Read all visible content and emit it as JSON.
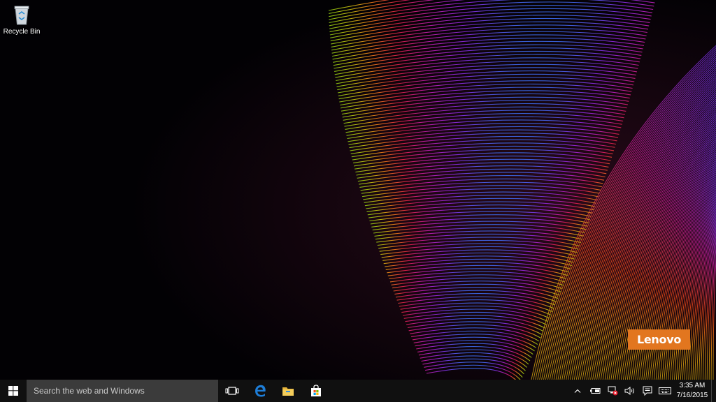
{
  "desktop": {
    "icons": [
      {
        "label": "Recycle Bin",
        "icon": "recycle-bin-icon"
      }
    ],
    "brand_logo": "Lenovo"
  },
  "taskbar": {
    "start_icon": "windows-logo-icon",
    "search_placeholder": "Search the web and Windows",
    "task_view_icon": "task-view-icon",
    "pinned": [
      {
        "icon": "edge-icon"
      },
      {
        "icon": "file-explorer-icon"
      },
      {
        "icon": "store-icon"
      }
    ],
    "tray": {
      "icons": [
        "chevron-up-icon",
        "battery-icon",
        "network-disconnected-icon",
        "volume-icon",
        "action-center-icon",
        "keyboard-icon"
      ],
      "time": "3:35 AM",
      "date": "7/16/2015"
    }
  },
  "colors": {
    "taskbar_bg": "#101010",
    "search_bg": "#3b3b3b",
    "brand": "#e2761f",
    "edge_blue": "#1e7ed8"
  }
}
